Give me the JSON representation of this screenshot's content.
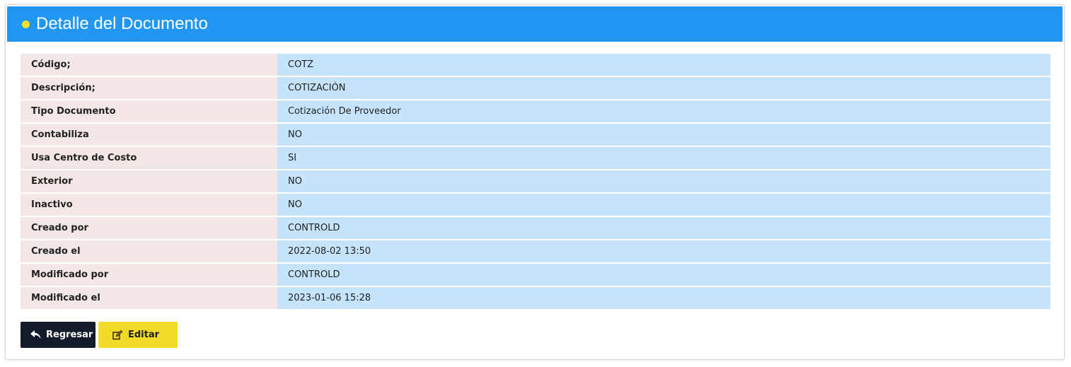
{
  "header": {
    "title": "Detalle del Documento",
    "dot_color": "#f5e12b",
    "background_color": "#2196f3"
  },
  "details": {
    "rows": [
      {
        "label": "Código;",
        "value": "COTZ"
      },
      {
        "label": "Descripción;",
        "value": "COTIZACIÓN"
      },
      {
        "label": "Tipo Documento",
        "value": "Cotización De Proveedor"
      },
      {
        "label": "Contabiliza",
        "value": "NO"
      },
      {
        "label": "Usa Centro de Costo",
        "value": "SI"
      },
      {
        "label": "Exterior",
        "value": "NO"
      },
      {
        "label": "Inactivo",
        "value": "NO"
      },
      {
        "label": "Creado por",
        "value": "CONTROLD"
      },
      {
        "label": "Creado el",
        "value": "2022-08-02 13:50"
      },
      {
        "label": "Modificado por",
        "value": "CONTROLD"
      },
      {
        "label": "Modificado el",
        "value": "2023-01-06 15:28"
      }
    ],
    "label_background": "#f2e6e6",
    "value_background": "#c5e3fa"
  },
  "actions": {
    "back_label": "Regresar",
    "back_icon": "reply-arrow-icon",
    "back_color": "#141b2a",
    "edit_label": "Editar",
    "edit_icon": "edit-icon",
    "edit_color": "#f2da28"
  }
}
